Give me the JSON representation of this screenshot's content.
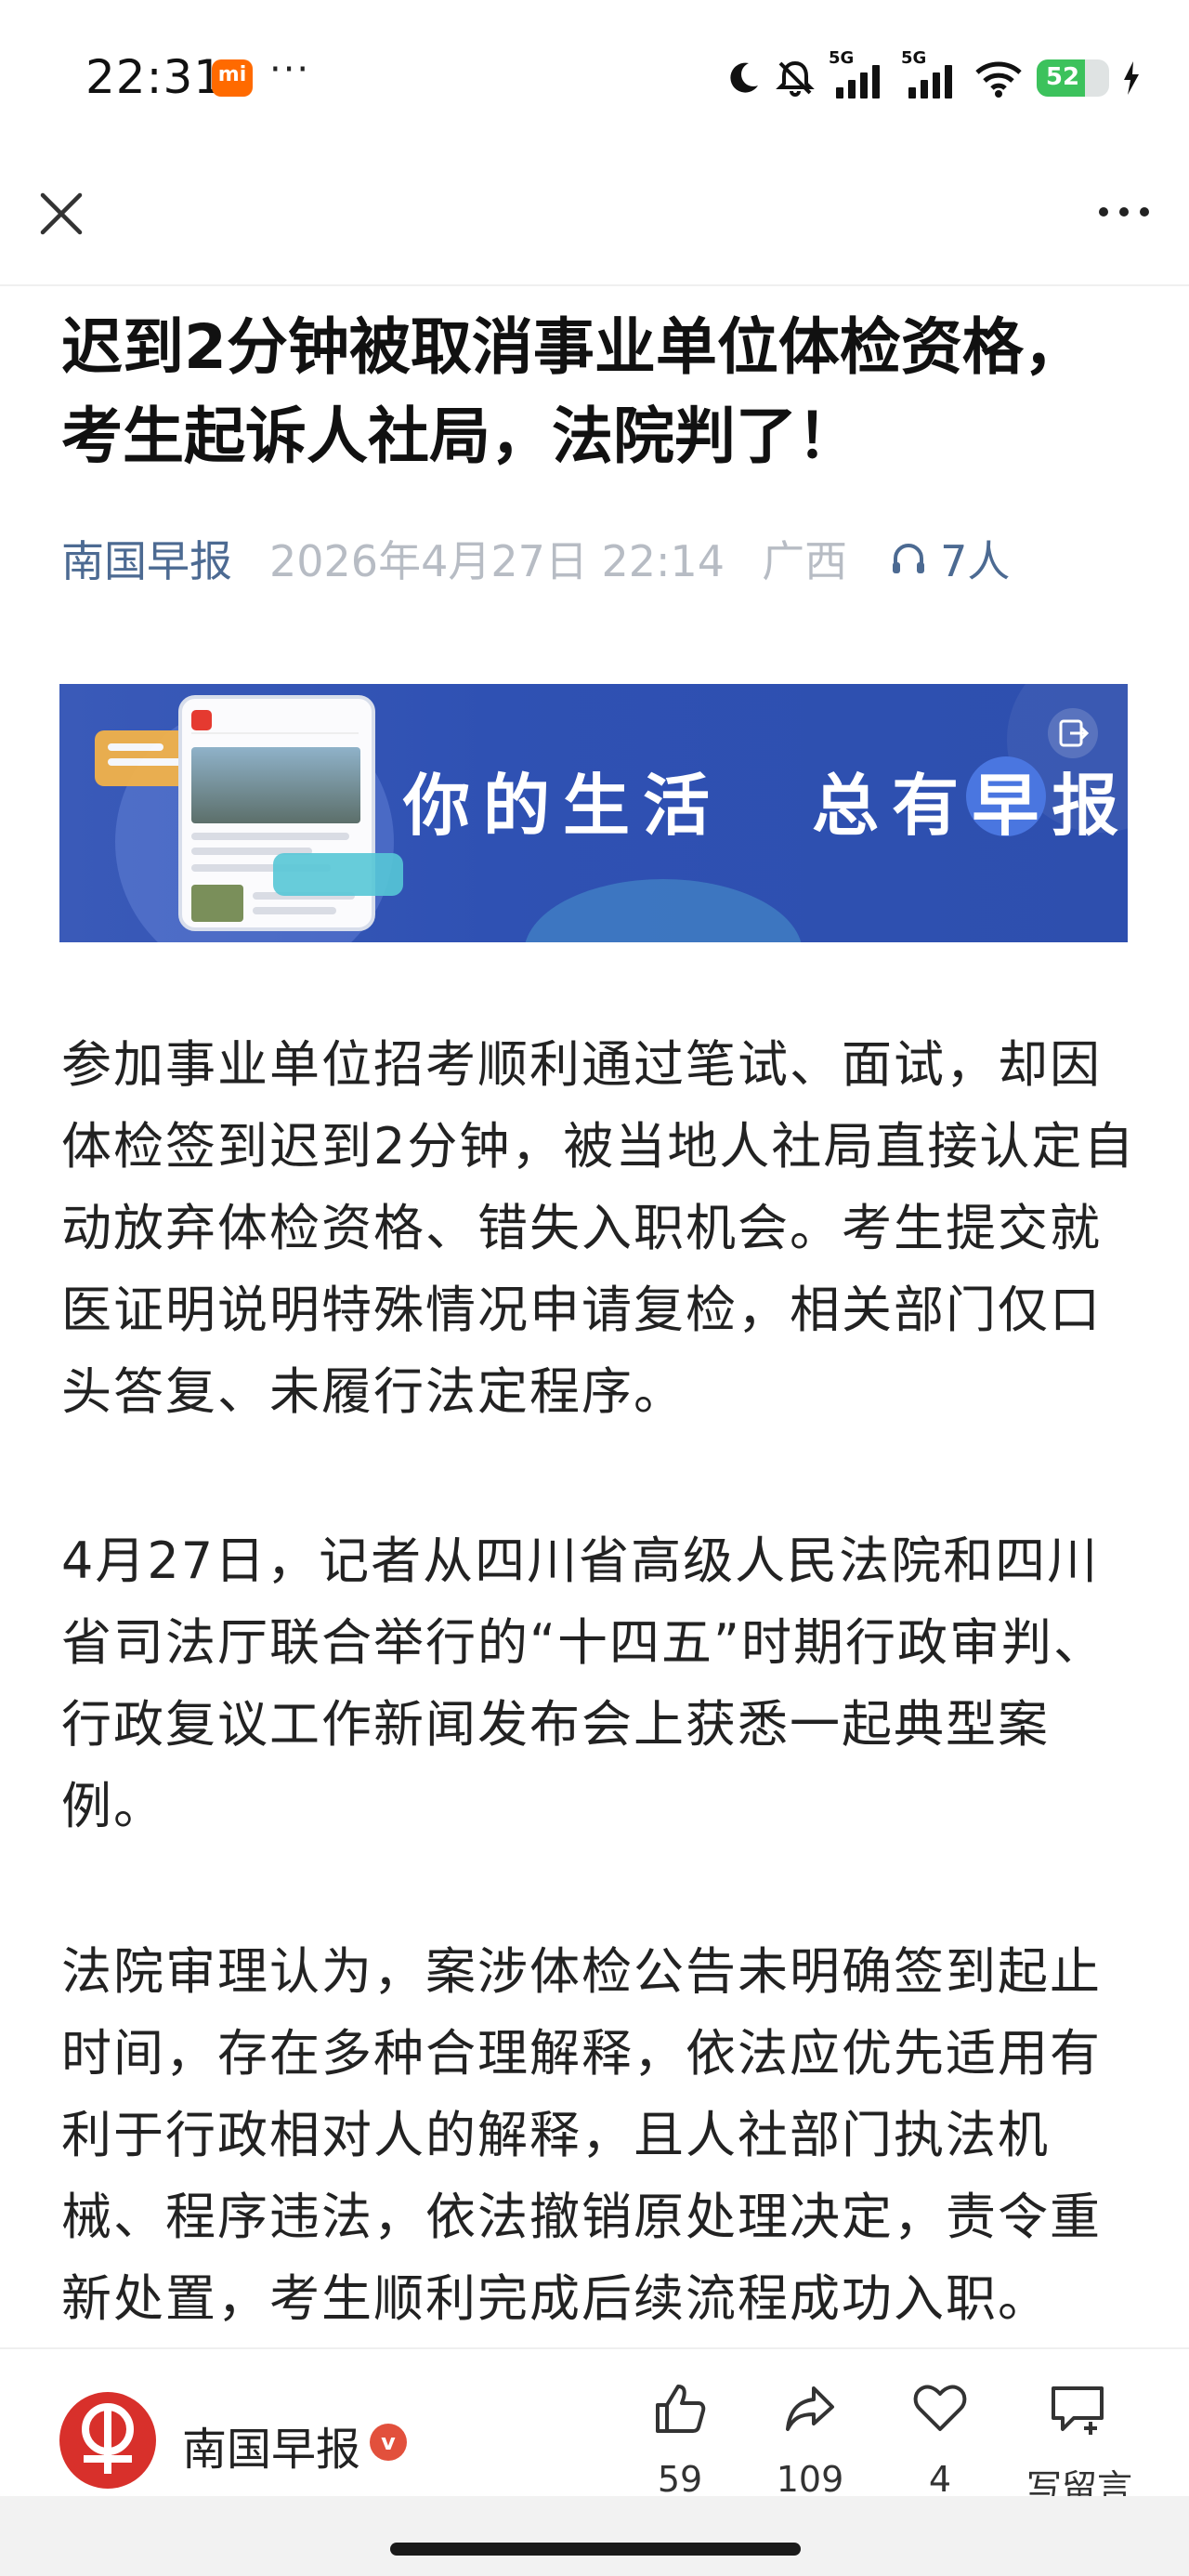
{
  "status_bar": {
    "time": "22:31",
    "mi_badge": "mi",
    "overflow": "···",
    "network1": "5G",
    "network2": "5G",
    "battery": "52",
    "battery_level": 0.52,
    "icons": [
      "moon-icon",
      "bell-off-icon",
      "signal-icon",
      "signal-icon",
      "wifi-icon",
      "battery-icon",
      "charging-icon"
    ]
  },
  "nav": {
    "close_icon": "close-icon",
    "more_icon": "more-icon"
  },
  "article": {
    "title": "迟到2分钟被取消事业单位体检资格，考生起诉人社局，法院判了！",
    "source": "南国早报",
    "date": "2026年4月27日 22:14",
    "location": "广西",
    "listeners": "7人",
    "banner_slogan_a": "你的生活",
    "banner_slogan_b": "总有",
    "banner_slogan_c": "早",
    "banner_slogan_d": "报",
    "paragraphs": [
      "参加事业单位招考顺利通过笔试、面试，却因体检签到迟到2分钟，被当地人社局直接认定自动放弃体检资格、错失入职机会。考生提交就医证明说明特殊情况申请复检，相关部门仅口头答复、未履行法定程序。",
      "4月27日，记者从四川省高级人民法院和四川省司法厅联合举行的“十四五”时期行政审判、行政复议工作新闻发布会上获悉一起典型案例。",
      "法院审理认为，案涉体检公告未明确签到起止时间，存在多种合理解释，依法应优先适用有利于行政相对人的解释，且人社部门执法机械、程序违法，依法撤销原处理决定，责令重新处置，考生顺利完成后续流程成功入职。"
    ]
  },
  "bottom_bar": {
    "publisher": "南国早报",
    "verified": "v",
    "like_count": "59",
    "share_count": "109",
    "fav_count": "4",
    "comment_label": "写留言"
  },
  "colors": {
    "accent_blue": "#4c6a92",
    "meta_gray": "#b7bcc4",
    "banner_blue": "#2f51b3",
    "brand_red": "#d8302b"
  }
}
